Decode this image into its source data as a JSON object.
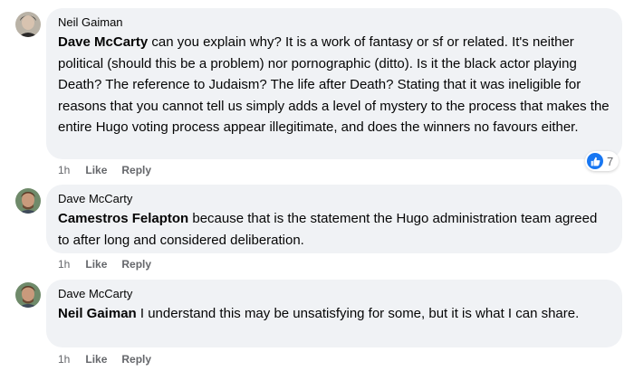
{
  "comments": [
    {
      "author": "Neil Gaiman",
      "mention": "Dave McCarty",
      "body": " can you explain why? It is a work of fantasy or sf or related. It's neither political (should this be a problem) nor pornographic (ditto). Is it the black actor playing Death? The reference to Judaism? The life after Death? Stating that it was ineligible for reasons that you cannot tell us simply adds a level of mystery to the process that makes the entire Hugo voting process appear illegitimate, and does the winners no favours either.",
      "time": "1h",
      "like_label": "Like",
      "reply_label": "Reply",
      "reaction_count": "7",
      "reaction_icon": "thumbs-up-icon"
    },
    {
      "author": "Dave McCarty",
      "mention": "Camestros Felapton",
      "body": " because that is the statement the Hugo administration team agreed to after long and considered deliberation.",
      "time": "1h",
      "like_label": "Like",
      "reply_label": "Reply"
    },
    {
      "author": "Dave McCarty",
      "mention": "Neil Gaiman",
      "body": " I understand this may be unsatisfying for some, but it is what I can share.",
      "time": "1h",
      "like_label": "Like",
      "reply_label": "Reply"
    }
  ],
  "colors": {
    "bubble": "#f0f2f5",
    "meta": "#65676b",
    "like_blue": "#1877f2"
  }
}
